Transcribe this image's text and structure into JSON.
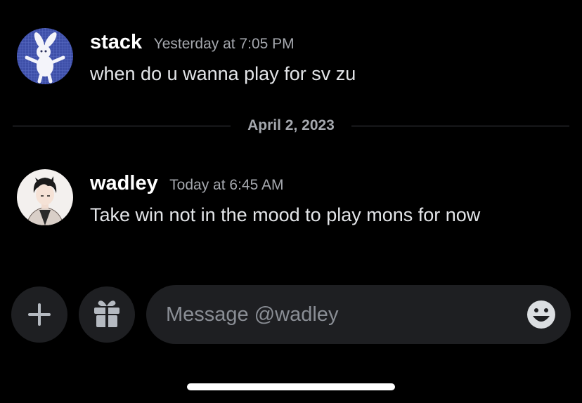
{
  "messages": [
    {
      "username": "stack",
      "timestamp": "Yesterday at 7:05 PM",
      "text": "when do u wanna play for sv zu",
      "avatar_icon": "bunny-avatar"
    },
    {
      "username": "wadley",
      "timestamp": "Today at 6:45 AM",
      "text": "Take win not in the mood to play mons for now",
      "avatar_icon": "anime-character-avatar"
    }
  ],
  "date_divider": "April 2, 2023",
  "composer": {
    "placeholder": "Message @wadley",
    "add_icon": "plus-icon",
    "gift_icon": "gift-icon",
    "emoji_icon": "emoji-smile-icon"
  },
  "colors": {
    "background": "#000000",
    "surface": "#1e1f22",
    "username": "#ffffff",
    "timestamp": "#a5a8ae",
    "text": "#e3e5e8",
    "icon": "#b5bac1"
  }
}
